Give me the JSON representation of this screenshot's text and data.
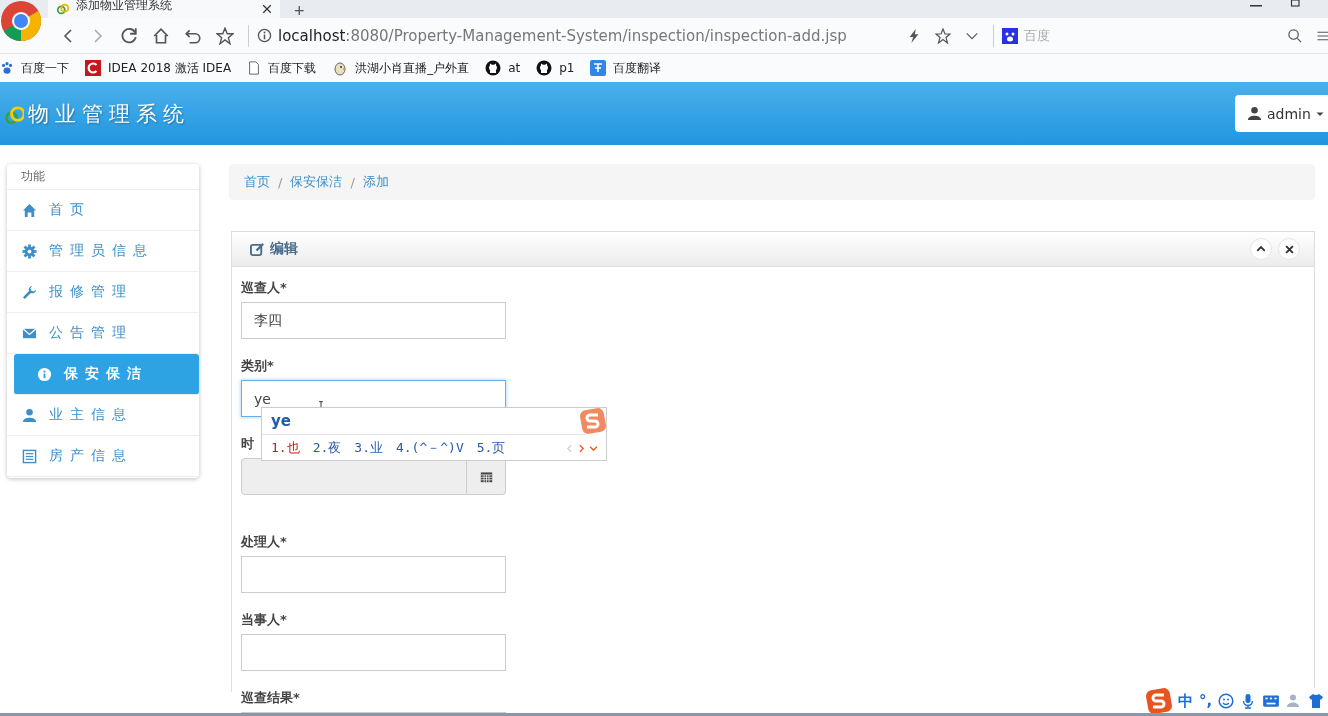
{
  "browser": {
    "tab_title": "添加物业管理系统",
    "new_tab": "+",
    "address_host": "localhost",
    "address_rest": ":8080/Property-Management-System/inspection/inspection-add.jsp",
    "search_placeholder": "百度",
    "bookmarks": [
      {
        "kind": "paw",
        "label": "百度一下"
      },
      {
        "kind": "red",
        "label": "IDEA 2018 激活 IDEA"
      },
      {
        "kind": "page",
        "label": "百度下载"
      },
      {
        "kind": "bird",
        "label": "洪湖小肖直播_户外直"
      },
      {
        "kind": "github",
        "label": "at"
      },
      {
        "kind": "github",
        "label": "p1"
      },
      {
        "kind": "translate",
        "label": "百度翻译"
      }
    ]
  },
  "app": {
    "title": "物业管理系统",
    "user": "admin"
  },
  "sidebar": {
    "heading": "功能",
    "items": [
      {
        "kind": "home",
        "label": "首页",
        "selected": false
      },
      {
        "kind": "gear",
        "label": "管理员信息",
        "selected": false
      },
      {
        "kind": "wrench",
        "label": "报修管理",
        "selected": false
      },
      {
        "kind": "envelope",
        "label": "公告管理",
        "selected": false
      },
      {
        "kind": "info",
        "label": "保安保洁",
        "selected": true
      },
      {
        "kind": "user",
        "label": "业主信息",
        "selected": false
      },
      {
        "kind": "list",
        "label": "房产信息",
        "selected": false
      }
    ]
  },
  "breadcrumb": {
    "separator": "/",
    "items": [
      "首页",
      "保安保洁",
      "添加"
    ]
  },
  "panel": {
    "title": "编辑",
    "fields": [
      {
        "kind": "text",
        "label": "巡查人*",
        "value": "李四",
        "focused": false
      },
      {
        "kind": "text",
        "label": "类别*",
        "value": "ye",
        "focused": true
      },
      {
        "kind": "date",
        "label": "时"
      },
      {
        "kind": "text",
        "label": "处理人*",
        "focused": false
      },
      {
        "kind": "text",
        "label": "当事人*",
        "focused": false
      },
      {
        "kind": "text",
        "label": "巡查结果*"
      }
    ]
  },
  "ime": {
    "composition": "ye",
    "candidates": [
      {
        "text": "1.也",
        "selected": true
      },
      {
        "text": "2.夜",
        "selected": false
      },
      {
        "text": "3.业",
        "selected": false
      },
      {
        "text": "4.(^－^)V",
        "selected": false
      },
      {
        "text": "5.页",
        "selected": false
      }
    ],
    "status": {
      "mode": "中",
      "punct": "°,"
    }
  }
}
